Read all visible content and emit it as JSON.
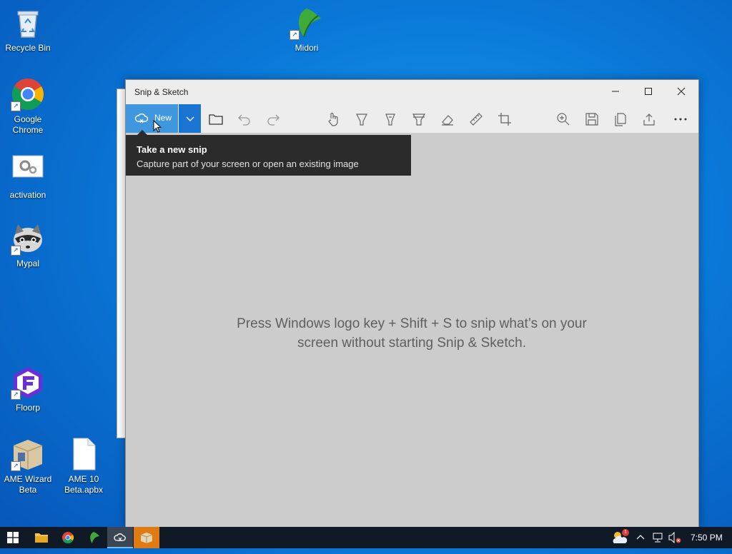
{
  "desktop": {
    "icons": [
      {
        "label": "Recycle Bin"
      },
      {
        "label": "Midori"
      },
      {
        "label": "Google Chrome"
      },
      {
        "label": "activation"
      },
      {
        "label": "Mypal"
      },
      {
        "label": "Floorp"
      },
      {
        "label": "AME Wizard Beta"
      },
      {
        "label": "AME 10 Beta.apbx"
      }
    ]
  },
  "window": {
    "title": "Snip & Sketch",
    "new_label": "New",
    "tooltip_title": "Take a new snip",
    "tooltip_desc": "Capture part of your screen or open an existing image",
    "hint_line1": "Press Windows logo key + Shift + S to snip what’s on your",
    "hint_line2": "screen without starting Snip & Sketch."
  },
  "taskbar": {
    "clock": "7:50 PM",
    "weather_badge": "1"
  },
  "colors": {
    "accent": "#1a74d2",
    "new_button": "#3f97e0",
    "canvas": "#cccccc"
  }
}
